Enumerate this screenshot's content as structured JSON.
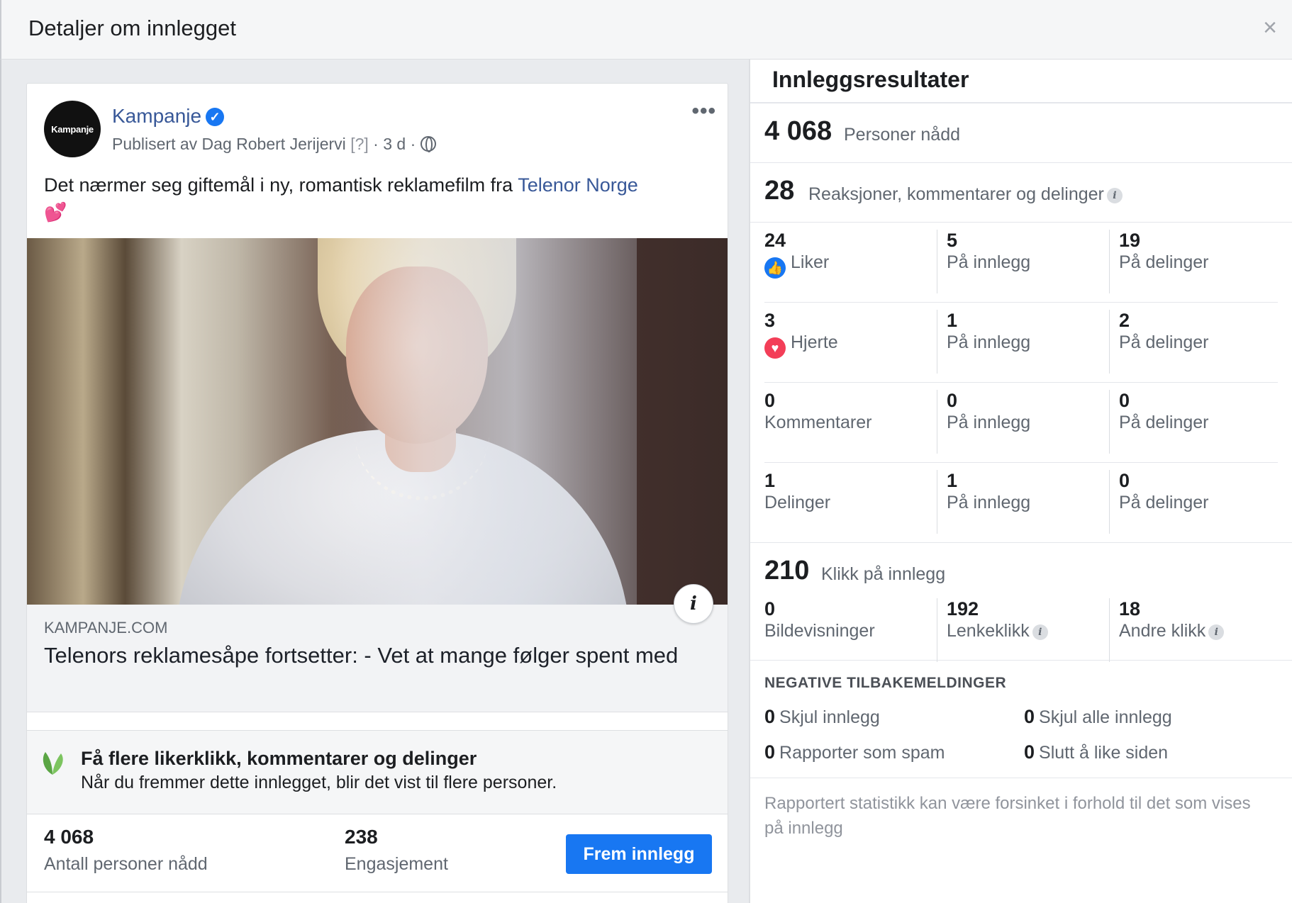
{
  "dialog": {
    "title": "Detaljer om innlegget",
    "close_glyph": "×"
  },
  "post": {
    "avatar_text": "Kampanje",
    "page_name": "Kampanje",
    "published_by": "Publisert av Dag Robert Jerijervi",
    "help_marker": "[?]",
    "age": "· 3 d ·",
    "more_glyph": "•••",
    "text": "Det nærmer seg giftemål i ny, romantisk reklamefilm fra ",
    "mention": "Telenor Norge",
    "emoji": "💕",
    "link": {
      "domain": "KAMPANJE.COM",
      "headline": "Telenors reklamesåpe fortsetter: - Vet at mange følger spent med"
    },
    "promo": {
      "title": "Få flere likerklikk, kommentarer og delinger",
      "subtitle": "Når du fremmer dette innlegget, blir det vist til flere personer."
    },
    "footer": {
      "reach_value": "4 068",
      "reach_label": "Antall personer nådd",
      "engagement_value": "238",
      "engagement_label": "Engasjement",
      "boost_label": "Frem innlegg"
    }
  },
  "results": {
    "header": "Innleggsresultater",
    "reach": {
      "value": "4 068",
      "label": "Personer nådd"
    },
    "reactions": {
      "value": "28",
      "label": "Reaksjoner, kommentarer og delinger"
    },
    "rows": [
      {
        "value": "24",
        "label": "Liker",
        "icon": "like-icon",
        "on_post": "5",
        "on_post_label": "På innlegg",
        "on_shares": "19",
        "on_shares_label": "På delinger"
      },
      {
        "value": "3",
        "label": "Hjerte",
        "icon": "love-icon",
        "on_post": "1",
        "on_post_label": "På innlegg",
        "on_shares": "2",
        "on_shares_label": "På delinger"
      },
      {
        "value": "0",
        "label": "Kommentarer",
        "icon": "",
        "on_post": "0",
        "on_post_label": "På innlegg",
        "on_shares": "0",
        "on_shares_label": "På delinger"
      },
      {
        "value": "1",
        "label": "Delinger",
        "icon": "",
        "on_post": "1",
        "on_post_label": "På innlegg",
        "on_shares": "0",
        "on_shares_label": "På delinger"
      }
    ],
    "clicks": {
      "value": "210",
      "label": "Klikk på innlegg",
      "photo_views": "0",
      "photo_views_label": "Bildevisninger",
      "link_clicks": "192",
      "link_clicks_label": "Lenkeklikk",
      "other_clicks": "18",
      "other_clicks_label": "Andre klikk"
    },
    "negative": {
      "title": "NEGATIVE TILBAKEMELDINGER",
      "hide_post": "0",
      "hide_post_label": "Skjul innlegg",
      "hide_all": "0",
      "hide_all_label": "Skjul alle innlegg",
      "spam": "0",
      "spam_label": "Rapporter som spam",
      "unlike": "0",
      "unlike_label": "Slutt å like siden"
    },
    "note": "Rapportert statistikk kan være forsinket i forhold til det som vises på innlegg"
  },
  "colors": {
    "accent": "#1877f2",
    "link": "#385898",
    "like": "#1877f2",
    "love": "#f33e58"
  }
}
